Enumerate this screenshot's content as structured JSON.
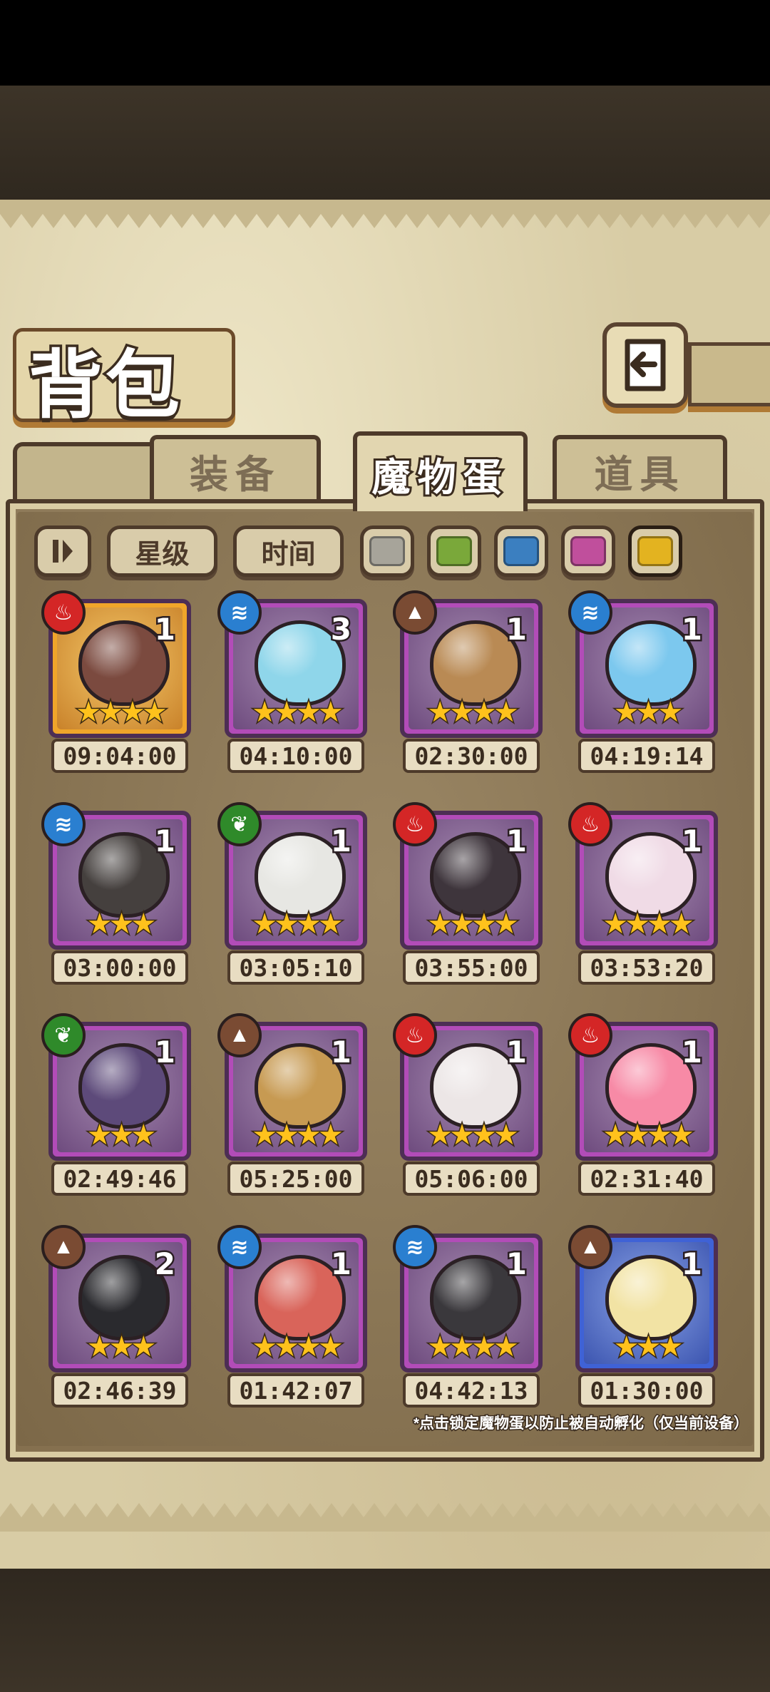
{
  "title": "背包",
  "tabs": [
    {
      "label": "装备",
      "active": false
    },
    {
      "label": "魔物蛋",
      "active": true
    },
    {
      "label": "道具",
      "active": false
    }
  ],
  "filters": {
    "sort_icon": "sort-toggle-icon",
    "star_label": "星级",
    "time_label": "时间",
    "rarity_colors": [
      "#a7a49a",
      "#7aa83a",
      "#3b7fc0",
      "#c04f9c",
      "#e3b320"
    ]
  },
  "eggs": [
    {
      "element": "fire",
      "count": "1",
      "stars": 4,
      "timer": "09:04:00",
      "frame": "gold",
      "egg_color": "#7b4a3f"
    },
    {
      "element": "water",
      "count": "3",
      "stars": 4,
      "timer": "04:10:00",
      "frame": "purple",
      "egg_color": "#8fd6ea"
    },
    {
      "element": "earth",
      "count": "1",
      "stars": 4,
      "timer": "02:30:00",
      "frame": "purple",
      "egg_color": "#b98a54"
    },
    {
      "element": "water",
      "count": "1",
      "stars": 3,
      "timer": "04:19:14",
      "frame": "purple",
      "egg_color": "#7cc8ee"
    },
    {
      "element": "water",
      "count": "1",
      "stars": 3,
      "timer": "03:00:00",
      "frame": "purple",
      "egg_color": "#45403e"
    },
    {
      "element": "wood",
      "count": "1",
      "stars": 4,
      "timer": "03:05:10",
      "frame": "purple",
      "egg_color": "#e7e7e3"
    },
    {
      "element": "fire",
      "count": "1",
      "stars": 4,
      "timer": "03:55:00",
      "frame": "purple",
      "egg_color": "#3e353c"
    },
    {
      "element": "fire",
      "count": "1",
      "stars": 4,
      "timer": "03:53:20",
      "frame": "purple",
      "egg_color": "#f0dbe6"
    },
    {
      "element": "wood",
      "count": "1",
      "stars": 3,
      "timer": "02:49:46",
      "frame": "purple",
      "egg_color": "#5d4a7a"
    },
    {
      "element": "earth",
      "count": "1",
      "stars": 4,
      "timer": "05:25:00",
      "frame": "purple",
      "egg_color": "#c79a52"
    },
    {
      "element": "fire",
      "count": "1",
      "stars": 4,
      "timer": "05:06:00",
      "frame": "purple",
      "egg_color": "#ece6e6"
    },
    {
      "element": "fire",
      "count": "1",
      "stars": 4,
      "timer": "02:31:40",
      "frame": "purple",
      "egg_color": "#f78aa6"
    },
    {
      "element": "earth",
      "count": "2",
      "stars": 3,
      "timer": "02:46:39",
      "frame": "purple",
      "egg_color": "#2a2a2e"
    },
    {
      "element": "water",
      "count": "1",
      "stars": 4,
      "timer": "01:42:07",
      "frame": "purple",
      "egg_color": "#d9645a"
    },
    {
      "element": "water",
      "count": "1",
      "stars": 4,
      "timer": "04:42:13",
      "frame": "purple",
      "egg_color": "#3a383c"
    },
    {
      "element": "earth",
      "count": "1",
      "stars": 3,
      "timer": "01:30:00",
      "frame": "blue",
      "egg_color": "#f2e3a4"
    }
  ],
  "element_colors": {
    "fire": "#d42626",
    "water": "#2a7fd0",
    "earth": "#7a4b33",
    "wood": "#2f8a2a"
  },
  "element_glyphs": {
    "fire": "♨",
    "water": "≋",
    "earth": "▲",
    "wood": "❦"
  },
  "frame_colors": {
    "gold": "#f0a52a",
    "purple": "#b24cb8",
    "blue": "#3f62d6"
  },
  "footnote": "*点击锁定魔物蛋以防止被自动孵化（仅当前设备）"
}
